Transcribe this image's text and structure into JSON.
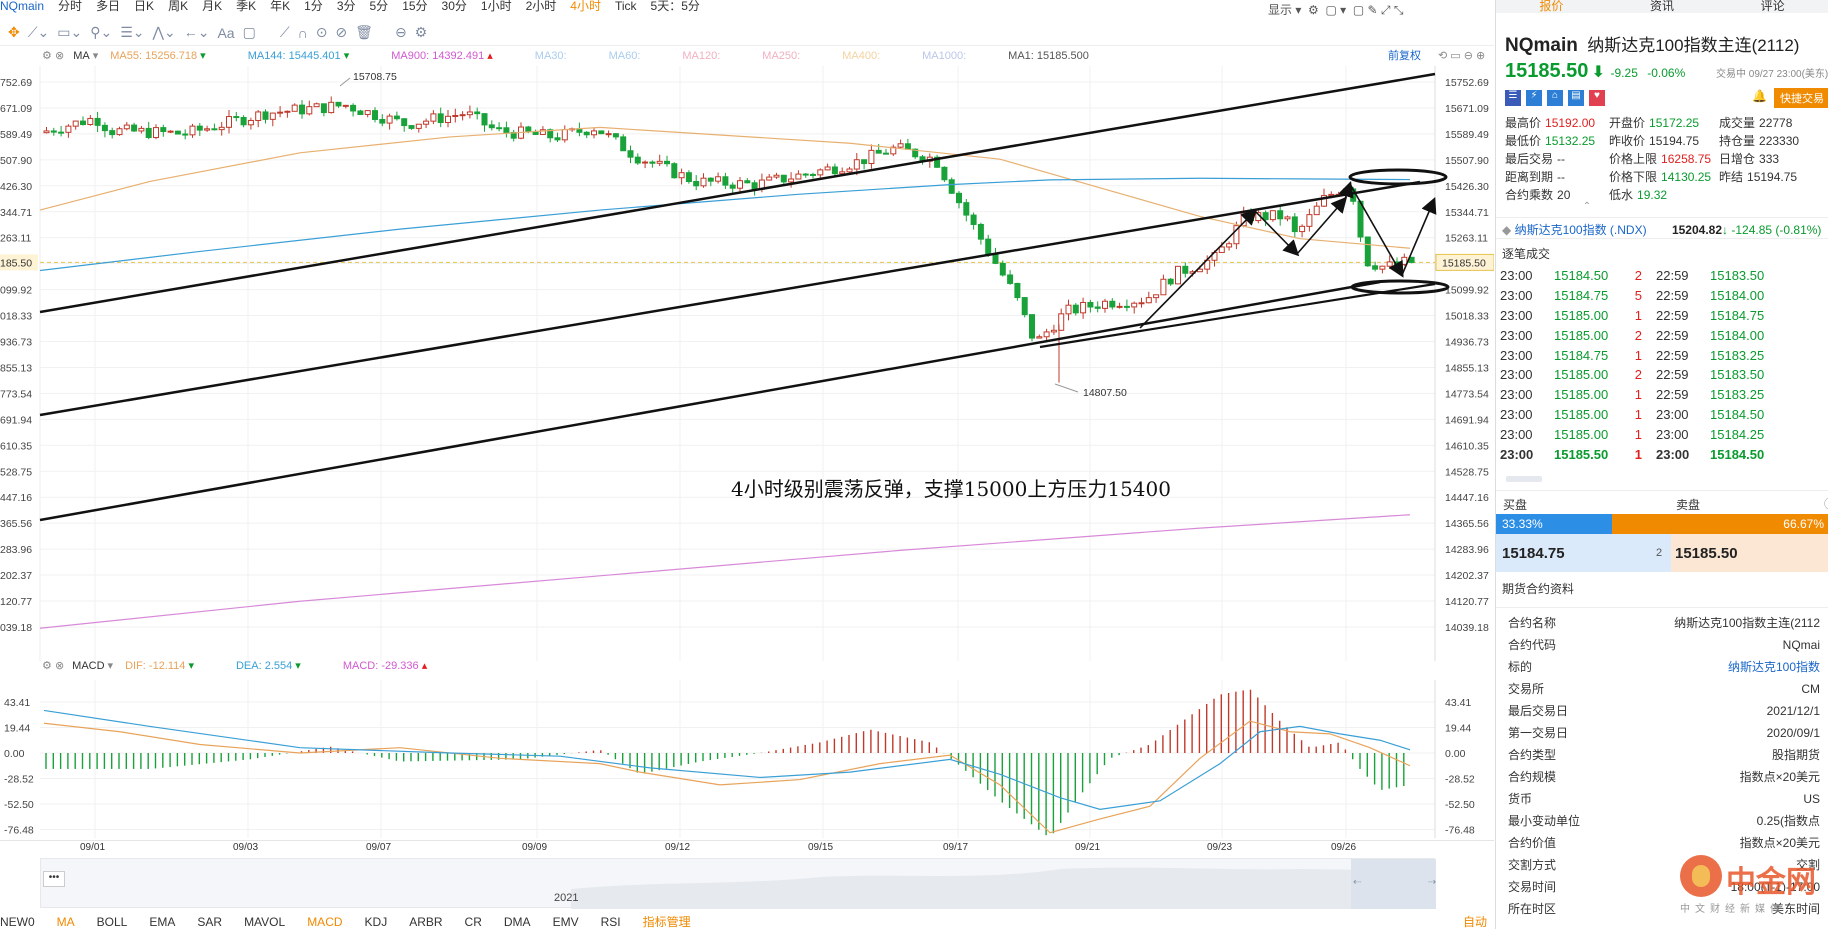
{
  "periods": [
    "分时",
    "多日",
    "日K",
    "周K",
    "月K",
    "季K",
    "年K",
    "1分",
    "3分",
    "5分",
    "15分",
    "30分",
    "1小时",
    "2小时",
    "4小时",
    "Tick",
    "5天：5分"
  ],
  "active_period": "4小时",
  "symbol_link": "NQmain",
  "toolbar_right": "显示",
  "legend": {
    "ma_name": "MA",
    "ma55": "MA55: 15256.718",
    "ma144": "MA144: 15445.401",
    "ma900": "MA900: 14392.491",
    "ma30": "MA30:",
    "ma60": "MA60:",
    "ma120": "MA120:",
    "ma250": "MA250:",
    "ma400": "MA400:",
    "ma1000": "MA1000:",
    "ma1": "MA1: 15185.500",
    "adjust": "前复权"
  },
  "macd_legend": {
    "name": "MACD",
    "dif": "DIF: -12.114",
    "dea": "DEA: 2.554",
    "macd": "MACD: -29.336"
  },
  "price_axis": [
    "15752.69",
    "15671.09",
    "15589.49",
    "15507.90",
    "15426.30",
    "15344.71",
    "15263.11",
    "15181.52",
    "15099.92",
    "15018.33",
    "14936.73",
    "14855.13",
    "14773.54",
    "14691.94",
    "14610.35",
    "14528.75",
    "14447.16",
    "14365.56",
    "14283.96",
    "14202.37",
    "14120.77",
    "14039.18"
  ],
  "price_axis_left": [
    "752.69",
    "671.09",
    "589.49",
    "507.90",
    "426.30",
    "344.71",
    "263.11",
    "185.50",
    "099.92",
    "018.33",
    "936.73",
    "855.13",
    "773.54",
    "691.94",
    "610.35",
    "528.75",
    "447.16",
    "365.56",
    "283.96",
    "202.37",
    "120.77",
    "039.18"
  ],
  "current_price": "15185.50",
  "macd_axis": [
    "43.41",
    "19.44",
    "0.00",
    "-28.52",
    "-52.50",
    "-76.48"
  ],
  "macd_axis_left": [
    "43.41",
    "19.44",
    "0.00",
    "-28.52",
    "-52.50",
    "-76.48"
  ],
  "dates": [
    "09/01",
    "09/03",
    "09/07",
    "09/09",
    "09/12",
    "09/15",
    "09/17",
    "09/21",
    "09/23",
    "09/26"
  ],
  "high_label": "15708.75",
  "low_label": "14807.50",
  "annotation": "4小时级别震荡反弹，支撑15000上方压力15400",
  "nav_year": "2021",
  "bottom_indicators": [
    "NEW0",
    "MA",
    "BOLL",
    "EMA",
    "SAR",
    "MAVOL",
    "MACD",
    "KDJ",
    "ARBR",
    "CR",
    "DMA",
    "EMV",
    "RSI",
    "指标管理"
  ],
  "bottom_right": "自动",
  "right": {
    "tabs": [
      "报价",
      "资讯",
      "评论"
    ],
    "symbol": "NQmain",
    "name": "纳斯达克100指数主连(2112)",
    "price": "15185.50",
    "change": "-9.25",
    "pct": "-0.06%",
    "trading": "交易中 09/27 23:00(美东)",
    "quick_trade": "快捷交易",
    "stats": [
      {
        "k": "最高价",
        "v": "15192.00",
        "c": "red"
      },
      {
        "k": "开盘价",
        "v": "15172.25",
        "c": "green"
      },
      {
        "k": "成交量",
        "v": "22778",
        "c": ""
      },
      {
        "k": "最低价",
        "v": "15132.25",
        "c": "green"
      },
      {
        "k": "昨收价",
        "v": "15194.75",
        "c": ""
      },
      {
        "k": "持仓量",
        "v": "223330",
        "c": ""
      },
      {
        "k": "最后交易",
        "v": "--",
        "c": ""
      },
      {
        "k": "价格上限",
        "v": "16258.75",
        "c": "red"
      },
      {
        "k": "日增仓",
        "v": "333",
        "c": ""
      },
      {
        "k": "距离到期",
        "v": "--",
        "c": ""
      },
      {
        "k": "价格下限",
        "v": "14130.25",
        "c": "green"
      },
      {
        "k": "昨结",
        "v": "15194.75",
        "c": ""
      },
      {
        "k": "合约乘数",
        "v": "20",
        "c": ""
      },
      {
        "k": "低水",
        "v": "19.32",
        "c": "green"
      },
      {
        "k": "",
        "v": "",
        "c": ""
      }
    ],
    "index_name": "纳斯达克100指数 (.NDX)",
    "index_price": "15204.82",
    "index_change": "-124.85",
    "index_pct": "(-0.81%)",
    "trade_title": "逐笔成交",
    "trades": [
      [
        "23:00",
        "15184.50",
        "2",
        "22:59",
        "15183.50"
      ],
      [
        "23:00",
        "15184.75",
        "5",
        "22:59",
        "15184.00"
      ],
      [
        "23:00",
        "15185.00",
        "1",
        "22:59",
        "15184.75"
      ],
      [
        "23:00",
        "15185.00",
        "2",
        "22:59",
        "15184.00"
      ],
      [
        "23:00",
        "15184.75",
        "1",
        "22:59",
        "15183.25"
      ],
      [
        "23:00",
        "15185.00",
        "2",
        "22:59",
        "15183.50"
      ],
      [
        "23:00",
        "15185.00",
        "1",
        "22:59",
        "15183.25"
      ],
      [
        "23:00",
        "15185.00",
        "1",
        "23:00",
        "15184.50"
      ],
      [
        "23:00",
        "15185.00",
        "1",
        "23:00",
        "15184.25"
      ],
      [
        "23:00",
        "15185.50",
        "1",
        "23:00",
        "15184.50"
      ]
    ],
    "buy_label": "买盘",
    "sell_label": "卖盘",
    "buy_pct": "33.33%",
    "sell_pct": "66.67%",
    "bid": "15184.75",
    "bid_qty": "2",
    "ask": "15185.50",
    "info_title": "期货合约资料",
    "info": [
      {
        "k": "合约名称",
        "v": "纳斯达克100指数主连(2112"
      },
      {
        "k": "合约代码",
        "v": "NQmai"
      },
      {
        "k": "标的",
        "v": "纳斯达克100指数"
      },
      {
        "k": "交易所",
        "v": "CM"
      },
      {
        "k": "最后交易日",
        "v": "2021/12/1"
      },
      {
        "k": "第一交易日",
        "v": "2020/09/1"
      },
      {
        "k": "合约类型",
        "v": "股指期货"
      },
      {
        "k": "合约规模",
        "v": "指数点×20美元"
      },
      {
        "k": "货币",
        "v": "US"
      },
      {
        "k": "最小变动单位",
        "v": "0.25(指数点"
      },
      {
        "k": "合约价值",
        "v": "指数点×20美元"
      },
      {
        "k": "交割方式",
        "v": "交割"
      },
      {
        "k": "交易时间",
        "v": "18:00(T-1)-17:00"
      },
      {
        "k": "所在时区",
        "v": "美东时间"
      }
    ],
    "watermark_main": "中金网",
    "watermark_sub": "中文财经新媒体"
  }
}
